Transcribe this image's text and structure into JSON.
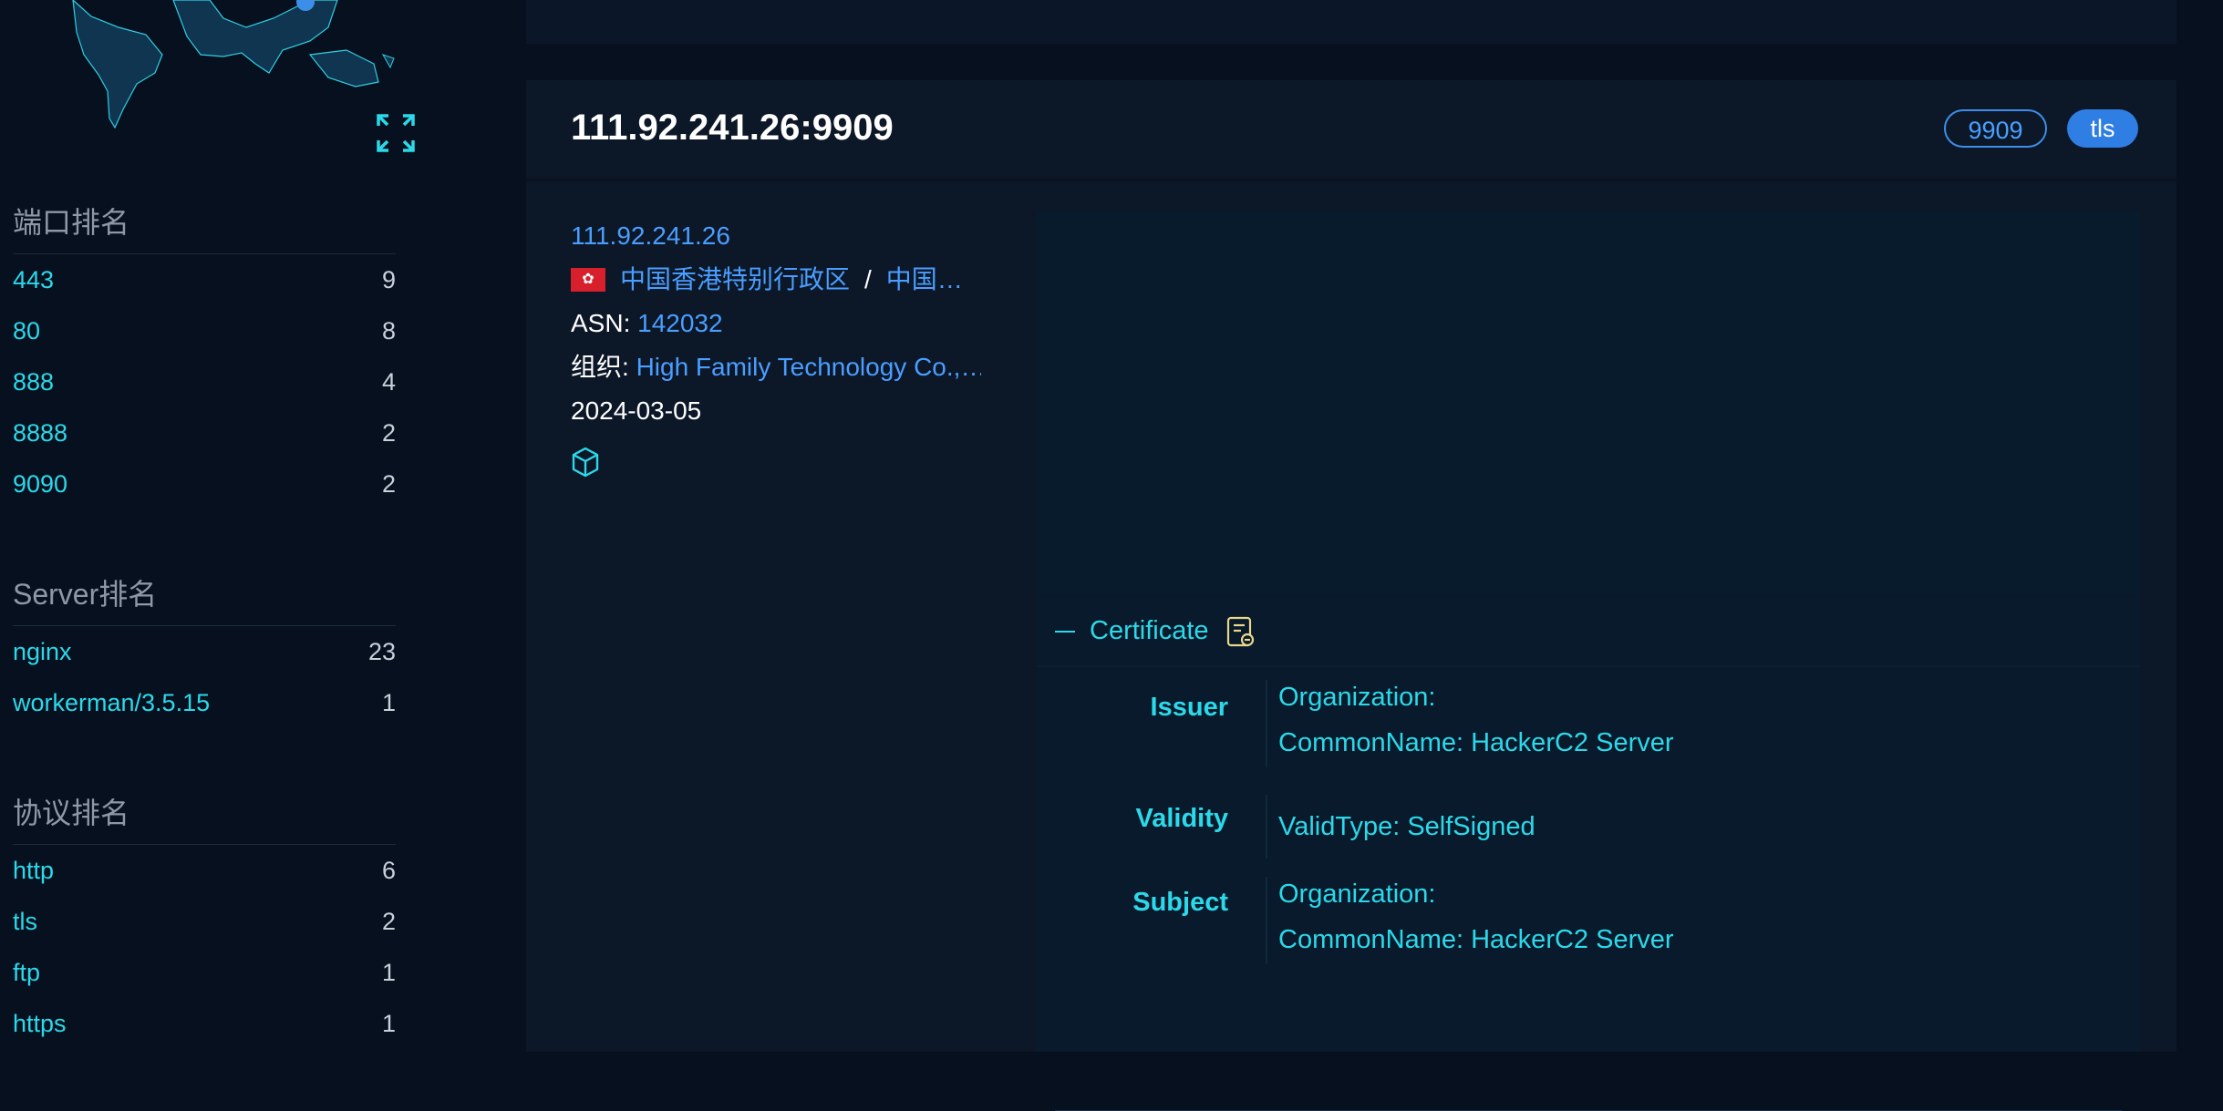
{
  "sidebar": {
    "sections": [
      {
        "title": "端口排名",
        "items": [
          {
            "key": "443",
            "count": "9"
          },
          {
            "key": "80",
            "count": "8"
          },
          {
            "key": "888",
            "count": "4"
          },
          {
            "key": "8888",
            "count": "2"
          },
          {
            "key": "9090",
            "count": "2"
          }
        ]
      },
      {
        "title": "Server排名",
        "items": [
          {
            "key": "nginx",
            "count": "23"
          },
          {
            "key": "workerman/3.5.15",
            "count": "1"
          }
        ]
      },
      {
        "title": "协议排名",
        "items": [
          {
            "key": "http",
            "count": "6"
          },
          {
            "key": "tls",
            "count": "2"
          },
          {
            "key": "ftp",
            "count": "1"
          },
          {
            "key": "https",
            "count": "1"
          }
        ]
      }
    ]
  },
  "result": {
    "title": "111.92.241.26:9909",
    "port_badge": "9909",
    "protocol_badge": "tls",
    "ip": "111.92.241.26",
    "region": "中国香港特别行政区",
    "region_sep": "/",
    "country": "中国香港",
    "asn_label": "ASN:",
    "asn": "142032",
    "org_label": "组织:",
    "org": "High Family Technology Co., Limited",
    "date": "2024-03-05",
    "flag_icon": "hong-kong-flag-icon",
    "colors": {
      "accent": "#2bd9ea",
      "link": "#4a9eff",
      "badge": "#2f7ee3",
      "flag": "#d8202c"
    }
  },
  "certificate": {
    "toggle_label": "Certificate",
    "issuer_label": "Issuer",
    "issuer_org": "Organization:",
    "issuer_cn": "CommonName: HackerC2 Server",
    "validity_label": "Validity",
    "validity_type": "ValidType: SelfSigned",
    "subject_label": "Subject",
    "subject_org": "Organization:",
    "subject_cn": "CommonName: HackerC2 Server"
  }
}
